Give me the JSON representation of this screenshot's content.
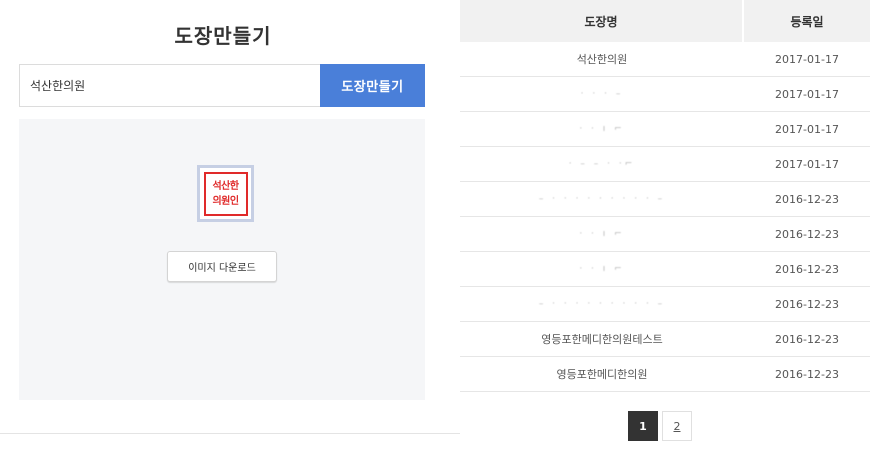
{
  "maker": {
    "title": "도장만들기",
    "input_value": "석산한의원",
    "button_label": "도장만들기",
    "seal_lines": [
      "석산한",
      "의원인"
    ],
    "download_label": "이미지 다운로드"
  },
  "table": {
    "headers": {
      "name": "도장명",
      "date": "등록일"
    },
    "rows": [
      {
        "name": "석산한의원",
        "date": "2017-01-17"
      },
      {
        "name": "· · · –",
        "date": "2017-01-17"
      },
      {
        "name": "· · ı ⌐",
        "date": "2017-01-17"
      },
      {
        "name": "· – – · ·⌐",
        "date": "2017-01-17"
      },
      {
        "name": "– · · · · · · · · · –",
        "date": "2016-12-23"
      },
      {
        "name": "· · ı ⌐",
        "date": "2016-12-23"
      },
      {
        "name": "· · ı ⌐",
        "date": "2016-12-23"
      },
      {
        "name": "– · · · · · · · · · –",
        "date": "2016-12-23"
      },
      {
        "name": "영등포한메디한의원테스트",
        "date": "2016-12-23"
      },
      {
        "name": "영등포한메디한의원",
        "date": "2016-12-23"
      }
    ]
  },
  "pagination": {
    "pages": [
      "1",
      "2"
    ],
    "current": "1"
  },
  "colors": {
    "accent": "#4a7fd9",
    "seal_red": "#e02a2a",
    "active_page": "#333333",
    "header_bg": "#f1f1f1",
    "preview_bg": "#f5f6f8"
  }
}
